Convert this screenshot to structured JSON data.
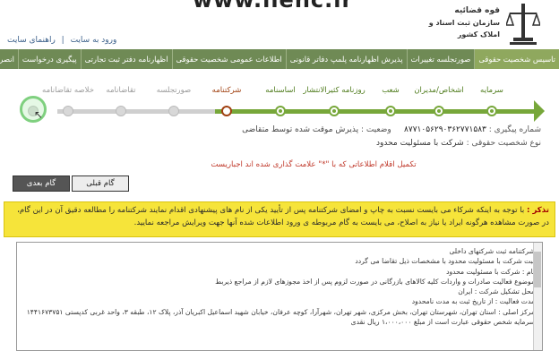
{
  "header": {
    "site_title": "www.ilenc.ir",
    "org_line1": "قوه قضائیه",
    "org_line2": "سازمان ثبت اسناد و املاک کشور",
    "login_link": "ورود به سایت",
    "guide_link": "راهنمای سایت"
  },
  "menu": [
    "تاسیس شخصیت حقوقی",
    "صورتجلسه تغییرات",
    "پذیرش اظهارنامه پلمپ دفاتر قانونی",
    "اطلاعات عمومی شخصیت حقوقی",
    "اظهارنامه دفتر ثبت تجارتی",
    "پیگیری درخواست",
    "انصراف از درخواست"
  ],
  "steps": [
    {
      "label": "سرمایه",
      "state": "done"
    },
    {
      "label": "اشخاص/مدیران",
      "state": "done"
    },
    {
      "label": "شعب",
      "state": "done"
    },
    {
      "label": "روزنامه کثیرالانتشار",
      "state": "done"
    },
    {
      "label": "اساسنامه",
      "state": "done"
    },
    {
      "label": "شرکتنامه",
      "state": "current"
    },
    {
      "label": "صورتجلسه",
      "state": "todo"
    },
    {
      "label": "تقاضانامه",
      "state": "todo"
    },
    {
      "label": "خلاصه تقاضانامه",
      "state": "todo"
    },
    {
      "label": "",
      "state": "todo"
    }
  ],
  "info": {
    "tracking_label": "شماره پیگیری :",
    "tracking_value": "۸۷۷۱۰۵۶۲۹۰۳۶۲۷۷۱۵۸۳",
    "status_label": "وضعیت :",
    "status_value": "پذیرش موقت شده توسط متقاضی",
    "entity_label": "نوع شخصیت حقوقی :",
    "entity_value": "شرکت با مسئولیت محدود"
  },
  "required_note": "تکمیل اقلام اطلاعاتی که با \"*\" علامت گذاری شده اند اجباریست",
  "buttons": {
    "next": "گام بعدی",
    "prev": "گام قبلی"
  },
  "warning": {
    "tag": "تذکر :",
    "text": "با توجه به اینکه شرکاء می بایست نسبت به چاپ و امضای شرکتنامه پس از تأیید یکی از نام های پیشنهادی اقدام نمایند شرکتنامه را مطالعه دقیق آن در این گام، در صورت مشاهده هرگونه ایراد یا نیاز به اصلاح، می بایست به گام مربوطه ی ورود اطلاعات شده آنها جهت ویرایش مراجعه نمایید."
  },
  "document_lines": [
    "شرکتنامه ثبت شرکتهای داخلی",
    "ثبت شرکت با مسئولیت محدود با مشخصات ذیل تقاضا می گردد",
    "نام : شرکت با مسئولیت محدود",
    "موضوع فعالیت صادرات و واردات کلیه کالاهای بازرگانی در صورت لزوم پس از اخذ مجوزهای لازم از مراجع ذیربط",
    "محل تشکیل شرکت : ایران",
    "مدت فعالیت : از تاریخ ثبت به مدت نامحدود",
    "مرکز اصلی : استان تهران، شهرستان تهران، بخش مرکزی، شهر تهران، شهرآرا، کوچه عرفان، خیابان شهید اسماعیل اکبریان آذر، پلاک ۱۲، طبقه ۳، واحد غربی کدپستی ۱۴۴۱۶۷۳۷۵۱",
    "سرمایه شخص حقوقی عبارت است از مبلغ ۱،۰۰۰،۰۰۰ ریال نقدی"
  ],
  "colors": {
    "menubar": "#6f8a55",
    "done": "#77a73a",
    "current": "#a04010",
    "warning_bg": "#f6e43a"
  }
}
